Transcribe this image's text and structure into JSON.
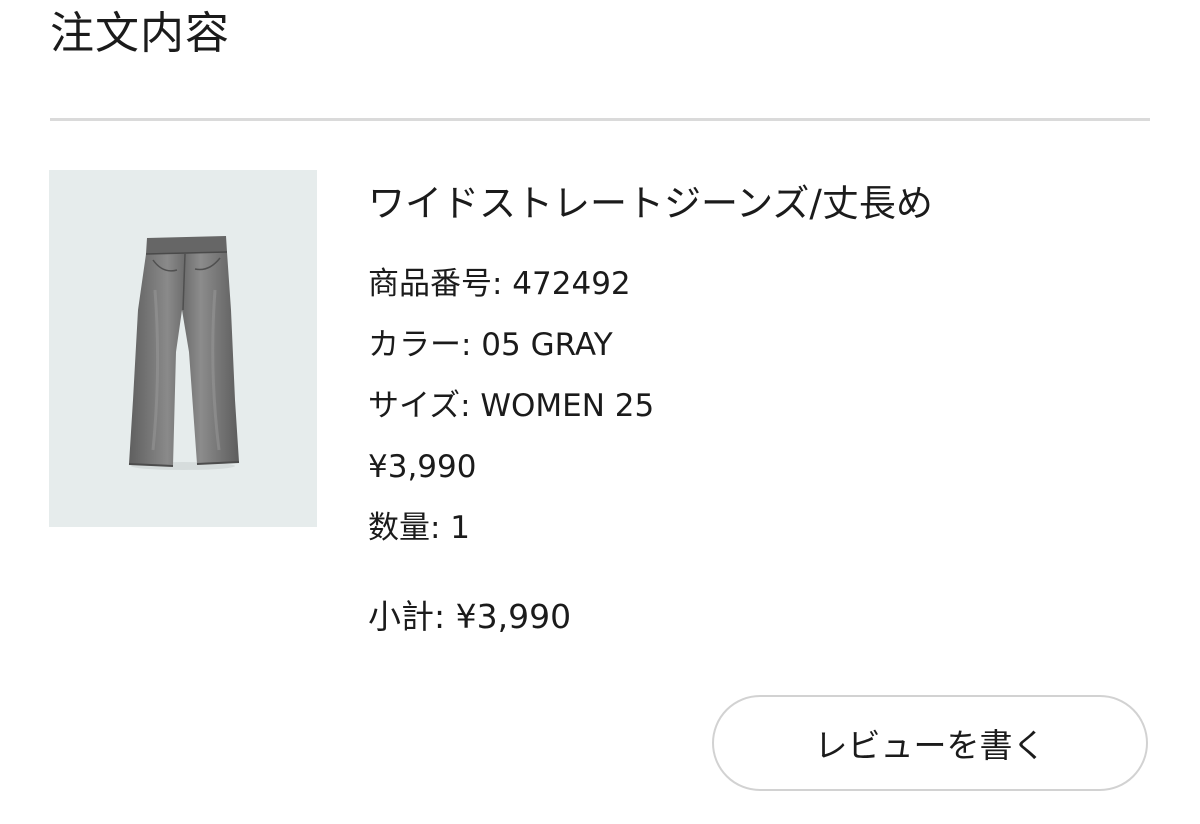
{
  "section": {
    "title": "注文内容"
  },
  "item": {
    "image": "gray-wide-straight-jeans-photo",
    "name": "ワイドストレートジーンズ/丈長め",
    "details": [
      "商品番号: 472492",
      "カラー: 05 GRAY",
      "サイズ: WOMEN 25",
      "¥3,990",
      "数量: 1"
    ],
    "subtotal": "小計: ¥3,990"
  },
  "actions": {
    "review_label": "レビューを書く"
  },
  "colors": {
    "image_background": "#e6ecec",
    "jeans_gray": "#7b7b7b",
    "divider": "#dadada",
    "button_border": "#d2d2d2",
    "text": "#1b1b1b"
  }
}
